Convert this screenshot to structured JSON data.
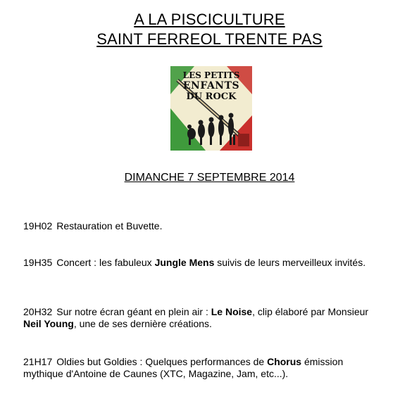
{
  "header": {
    "line1": "A LA PISCICULTURE ",
    "line2": "SAINT FERREOL TRENTE PAS"
  },
  "logo": {
    "line1": "LES PETITS",
    "line2": "ENFANTS",
    "line3": "DU ROCK",
    "colors": {
      "green": "#3f9a3c",
      "red": "#c9302c",
      "cream": "#f2ecd0"
    }
  },
  "event_date": "DIMANCHE 7 SEPTEMBRE 2014",
  "program": [
    {
      "time": "19H02",
      "text_a": "Restauration et Buvette."
    },
    {
      "time": "19H35",
      "text_a": "Concert : les fabuleux ",
      "bold_a": "Jungle Mens",
      "text_b": " suivis de leurs merveilleux invités."
    },
    {
      "time": "20H32",
      "text_a": "Sur notre écran géant en plein air : ",
      "bold_a": "Le Noise",
      "text_b": ", clip élaboré par Monsieur ",
      "bold_b": "Neil Young",
      "text_c": ", une de ses dernière créations."
    },
    {
      "time": "21H17",
      "text_a": "Oldies but Goldies : Quelques performances de ",
      "bold_a": "Chorus",
      "text_b": " émission mythique d'Antoine de Caunes (XTC, Magazine, Jam, etc...)."
    }
  ]
}
